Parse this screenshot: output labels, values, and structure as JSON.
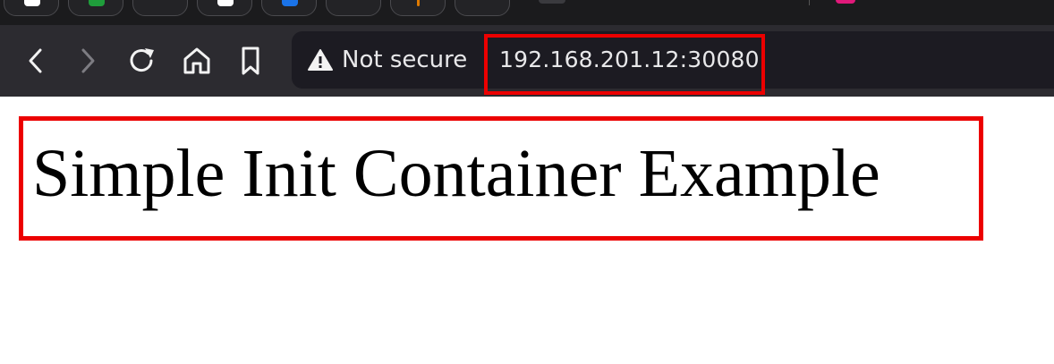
{
  "browser": {
    "tabs": [
      {
        "name": "tab-1",
        "favicon_color": "#ffffff"
      },
      {
        "name": "tab-2",
        "favicon_color": "#1f9d3b"
      },
      {
        "name": "tab-3",
        "favicon_color": ""
      },
      {
        "name": "tab-4",
        "favicon_color": "#ffffff"
      },
      {
        "name": "tab-5",
        "favicon_color": "#1a73e8"
      },
      {
        "name": "tab-6",
        "favicon_color": ""
      },
      {
        "name": "tab-7",
        "favicon_color": "#e07b00"
      },
      {
        "name": "tab-8",
        "favicon_color": ""
      }
    ],
    "toolbar": {
      "back_icon": "back-arrow-icon",
      "forward_icon": "forward-arrow-icon",
      "reload_icon": "reload-icon",
      "home_icon": "home-icon",
      "bookmark_icon": "bookmark-icon"
    },
    "address_bar": {
      "security_icon": "warning-triangle-icon",
      "security_text": "Not secure",
      "url": "192.168.201.12:30080"
    }
  },
  "page": {
    "heading": "Simple Init Container Example"
  },
  "colors": {
    "highlight": "#ec0000",
    "toolbar_bg": "#2c2b30",
    "tabstrip_bg": "#1b1b1d",
    "urlbar_bg": "#1c1b22",
    "text_light": "#e8e8ea"
  }
}
